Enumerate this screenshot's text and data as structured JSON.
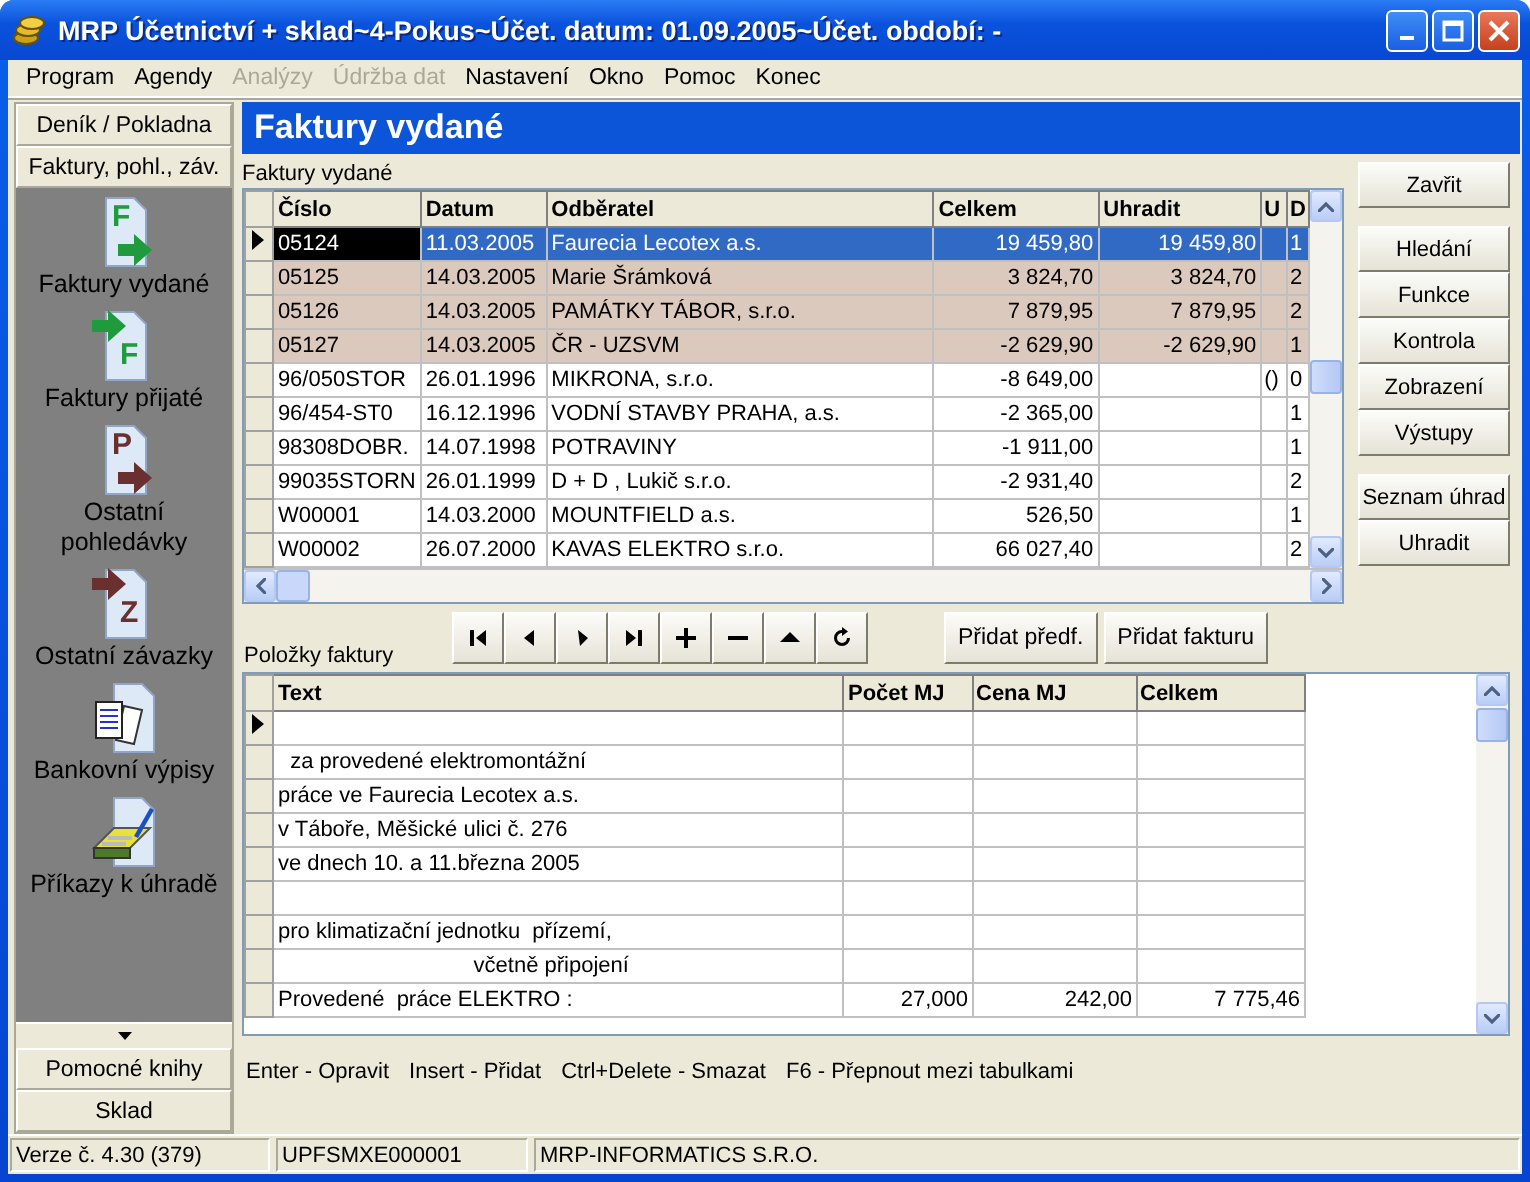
{
  "window": {
    "title": "MRP Účetnictví + sklad~4-Pokus~Účet. datum: 01.09.2005~Účet. období: -"
  },
  "menu": [
    {
      "label": "Program",
      "disabled": false
    },
    {
      "label": "Agendy",
      "disabled": false
    },
    {
      "label": "Analýzy",
      "disabled": true
    },
    {
      "label": "Údržba dat",
      "disabled": true
    },
    {
      "label": "Nastavení",
      "disabled": false
    },
    {
      "label": "Okno",
      "disabled": false
    },
    {
      "label": "Pomoc",
      "disabled": false
    },
    {
      "label": "Konec",
      "disabled": false
    }
  ],
  "sidebar": {
    "groups_top": [
      "Deník / Pokladna",
      "Faktury, pohl., záv."
    ],
    "items": [
      {
        "kind": "doc-out",
        "glyph": "F",
        "color": "#1f9a3c",
        "label": "Faktury vydané"
      },
      {
        "kind": "doc-in",
        "glyph": "F",
        "color": "#1f9a3c",
        "label": "Faktury přijaté"
      },
      {
        "kind": "doc-out",
        "glyph": "P",
        "color": "#6a2f2f",
        "label": "Ostatní pohledávky"
      },
      {
        "kind": "doc-in",
        "glyph": "Z",
        "color": "#6a2f2f",
        "label": "Ostatní závazky"
      },
      {
        "kind": "statements",
        "label": "Bankovní výpisy"
      },
      {
        "kind": "payment",
        "label": "Příkazy k úhradě"
      }
    ],
    "groups_bottom": [
      "Pomocné knihy",
      "Sklad"
    ]
  },
  "heading": "Faktury vydané",
  "invoices": {
    "label": "Faktury vydané",
    "columns": [
      "Číslo",
      "Datum",
      "Odběratel",
      "Celkem",
      "Uhradit",
      "U",
      "D"
    ],
    "rows": [
      {
        "selected": true,
        "marked": false,
        "number": "05124",
        "date": "11.03.2005",
        "customer": "Faurecia Lecotex a.s.",
        "total": "19 459,80",
        "to_pay": "19 459,80",
        "column_7": "1"
      },
      {
        "selected": false,
        "marked": true,
        "number": "05125",
        "date": "14.03.2005",
        "customer": "Marie Šrámková",
        "total": "3 824,70",
        "to_pay": "3 824,70",
        "column_7": "2"
      },
      {
        "selected": false,
        "marked": true,
        "number": "05126",
        "date": "14.03.2005",
        "customer": "PAMÁTKY TÁBOR, s.r.o.",
        "total": "7 879,95",
        "to_pay": "7 879,95",
        "column_7": "2"
      },
      {
        "selected": false,
        "marked": true,
        "number": "05127",
        "date": "14.03.2005",
        "customer": "ČR - UZSVM",
        "total": "-2 629,90",
        "to_pay": "-2 629,90",
        "column_7": "1"
      },
      {
        "selected": false,
        "marked": false,
        "number": "96/050STOR",
        "date": "26.01.1996",
        "customer": "MIKRONA, s.r.o.",
        "total": "-8 649,00",
        "column_6": "()",
        "column_7": "0"
      },
      {
        "selected": false,
        "marked": false,
        "number": "96/454-ST0",
        "date": "16.12.1996",
        "customer": "VODNÍ STAVBY PRAHA, a.s.",
        "total": "-2 365,00",
        "column_7": "1"
      },
      {
        "selected": false,
        "marked": false,
        "number": "98308DOBR.",
        "date": "14.07.1998",
        "customer": "POTRAVINY",
        "total": "-1 911,00",
        "column_7": "1"
      },
      {
        "selected": false,
        "marked": false,
        "number": "99035STORN",
        "date": "26.01.1999",
        "customer": "D + D ,  Lukič   s.r.o.",
        "total": "-2 931,40",
        "column_7": "2"
      },
      {
        "selected": false,
        "marked": false,
        "number": "W00001",
        "date": "14.03.2000",
        "customer": "MOUNTFIELD a.s.",
        "total": "526,50",
        "column_7": "1"
      },
      {
        "selected": false,
        "marked": false,
        "number": "W00002",
        "date": "26.07.2000",
        "customer": "KAVAS ELEKTRO s.r.o.",
        "total": "66 027,40",
        "column_7": "2"
      }
    ]
  },
  "side_buttons": [
    [
      "Zavřit"
    ],
    [
      "Hledání",
      "Funkce",
      "Kontrola",
      "Zobrazení",
      "Výstupy"
    ],
    [
      "Seznam úhrad",
      "Uhradit"
    ]
  ],
  "nav_buttons": [
    {
      "kind": "first"
    },
    {
      "kind": "prev"
    },
    {
      "kind": "next"
    },
    {
      "kind": "last"
    },
    {
      "kind": "add"
    },
    {
      "kind": "delete"
    },
    {
      "kind": "up"
    },
    {
      "kind": "refresh"
    }
  ],
  "action_buttons": [
    "Přidat předf.",
    "Přidat fakturu"
  ],
  "items": {
    "label": "Položky faktury",
    "columns": [
      "Text",
      "Počet MJ",
      "Cena MJ",
      "Celkem"
    ],
    "rows": [
      {
        "current": true
      },
      {
        "current": false,
        "text": "  za provedené elektromontážní"
      },
      {
        "current": false,
        "text": "práce ve Faurecia Lecotex a.s."
      },
      {
        "current": false,
        "text": "v Táboře, Měšické ulici č. 276"
      },
      {
        "current": false,
        "text": "ve dnech 10. a 11.března 2005"
      },
      {
        "current": false
      },
      {
        "current": false,
        "text": "pro klimatizační jednotku  přízemí,"
      },
      {
        "current": false,
        "text": "                                včetně připojení"
      },
      {
        "current": false,
        "text": "Provedené  práce ELEKTRO :",
        "count": "27,000",
        "price": "242,00",
        "total": "7 775,46"
      }
    ]
  },
  "hints": [
    "Enter - Opravit",
    "Insert - Přidat",
    "Ctrl+Delete - Smazat",
    "F6 - Přepnout mezi tabulkami"
  ],
  "status_bar": [
    "Verze č. 4.30 (379)",
    "UPFSMXE000001",
    "MRP-INFORMATICS S.R.O."
  ]
}
